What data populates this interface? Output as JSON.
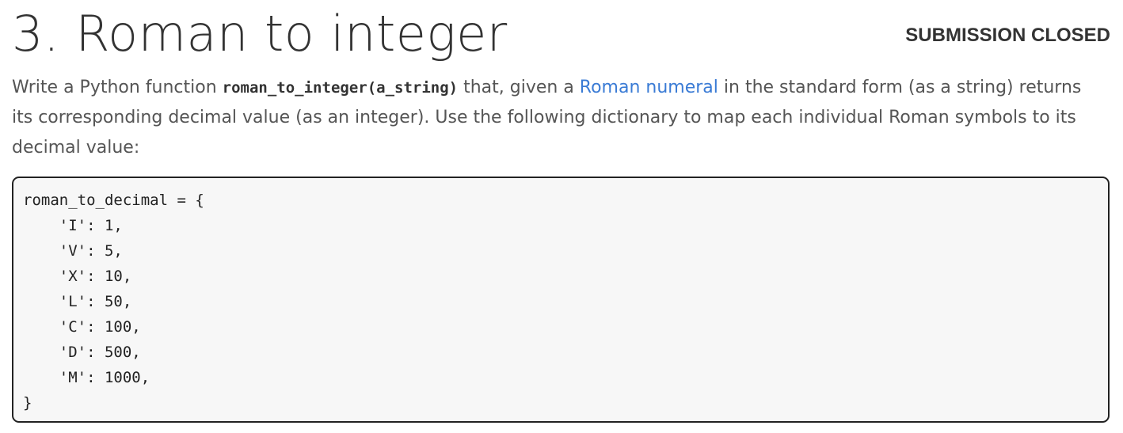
{
  "header": {
    "title": "3. Roman to integer",
    "status": "SUBMISSION CLOSED"
  },
  "description": {
    "part1": "Write a Python function ",
    "function_signature": "roman_to_integer(a_string)",
    "part2": " that, given a ",
    "link_text": "Roman numeral",
    "part3": " in the standard form (as a string) returns its corresponding decimal value (as an integer). Use the following dictionary to map each individual Roman symbols to its decimal value:"
  },
  "code": {
    "lines": [
      "roman_to_decimal = {",
      "    'I': 1,",
      "    'V': 5,",
      "    'X': 10,",
      "    'L': 50,",
      "    'C': 100,",
      "    'D': 500,",
      "    'M': 1000,",
      "}"
    ]
  },
  "colors": {
    "link": "#3a7bd5",
    "text": "#555555",
    "code_background": "#f7f7f7"
  }
}
